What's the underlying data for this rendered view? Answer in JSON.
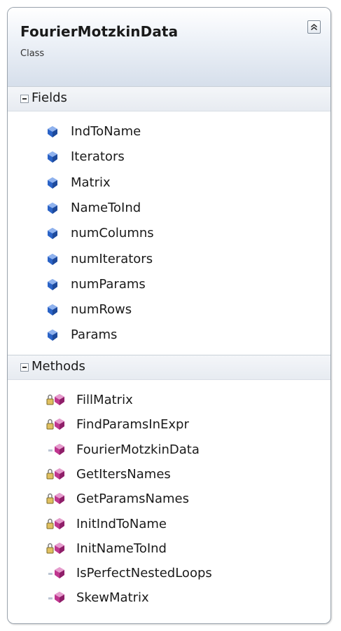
{
  "class_box": {
    "title": "FourierMotzkinData",
    "subtitle": "Class"
  },
  "sections": {
    "fields_title": "Fields",
    "methods_title": "Methods"
  },
  "fields": [
    {
      "name": "IndToName",
      "icon": "field-icon"
    },
    {
      "name": "Iterators",
      "icon": "field-icon"
    },
    {
      "name": "Matrix",
      "icon": "field-icon"
    },
    {
      "name": "NameToInd",
      "icon": "field-icon"
    },
    {
      "name": "numColumns",
      "icon": "field-icon"
    },
    {
      "name": "numIterators",
      "icon": "field-icon"
    },
    {
      "name": "numParams",
      "icon": "field-icon"
    },
    {
      "name": "numRows",
      "icon": "field-icon"
    },
    {
      "name": "Params",
      "icon": "field-icon"
    }
  ],
  "methods": [
    {
      "name": "FillMatrix",
      "icon": "private-method-icon"
    },
    {
      "name": "FindParamsInExpr",
      "icon": "private-method-icon"
    },
    {
      "name": "FourierMotzkinData",
      "icon": "public-method-icon"
    },
    {
      "name": "GetItersNames",
      "icon": "private-method-icon"
    },
    {
      "name": "GetParamsNames",
      "icon": "private-method-icon"
    },
    {
      "name": "InitIndToName",
      "icon": "private-method-icon"
    },
    {
      "name": "InitNameToInd",
      "icon": "private-method-icon"
    },
    {
      "name": "IsPerfectNestedLoops",
      "icon": "public-method-icon"
    },
    {
      "name": "SkewMatrix",
      "icon": "public-method-icon"
    }
  ],
  "colors": {
    "field_icon": "#2a63c7",
    "method_icon": "#c0368f",
    "header_gradient_end": "#d6dfeb"
  }
}
